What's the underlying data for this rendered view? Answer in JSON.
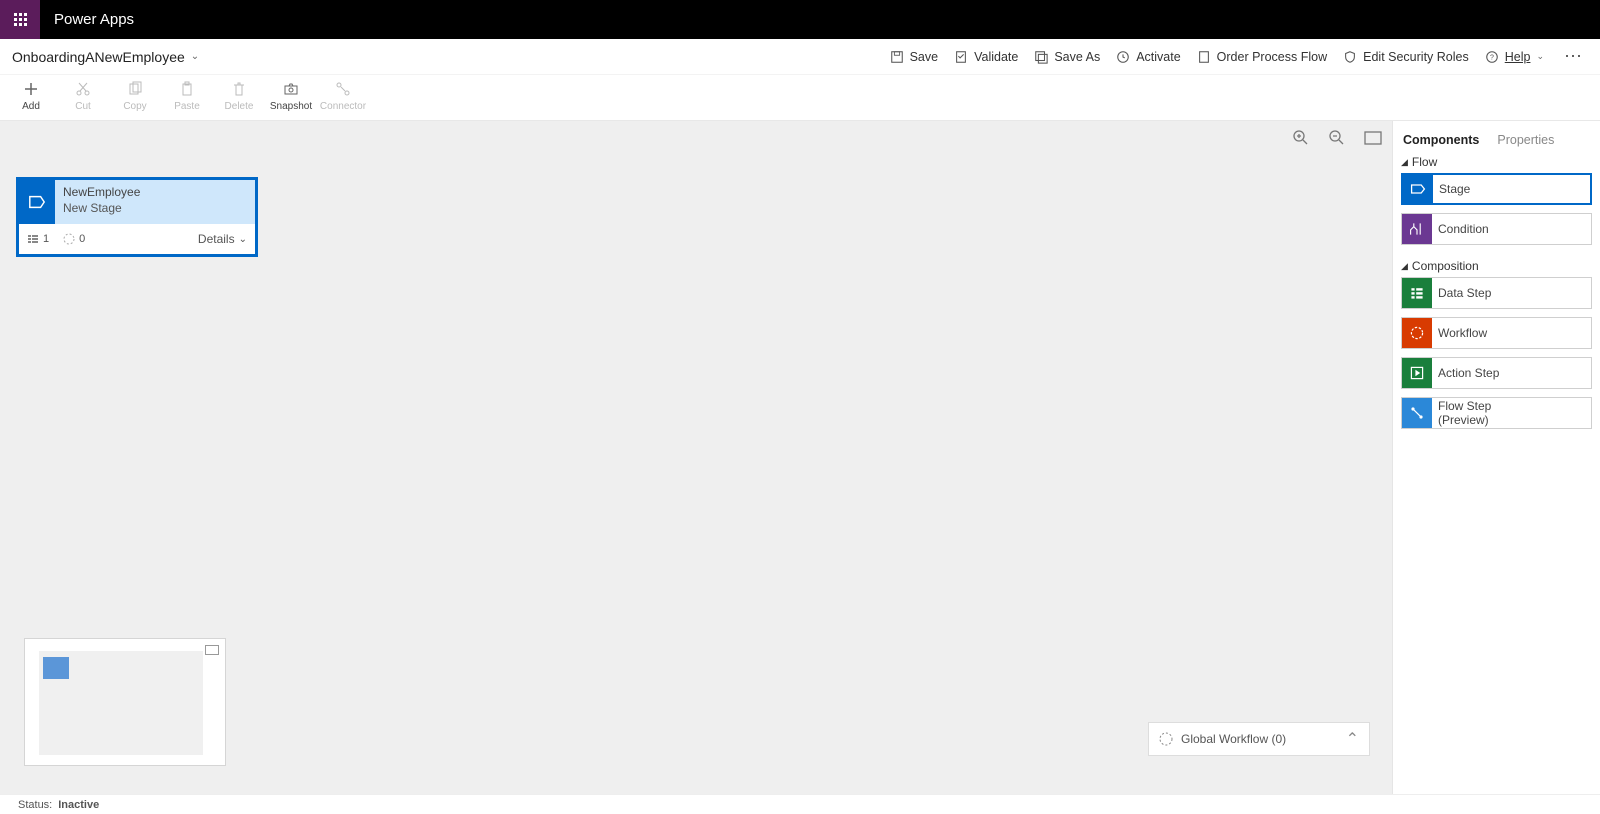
{
  "app": {
    "name": "Power Apps"
  },
  "process": {
    "name": "OnboardingANewEmployee"
  },
  "topActions": {
    "save": "Save",
    "validate": "Validate",
    "saveAs": "Save As",
    "activate": "Activate",
    "orderProcessFlow": "Order Process Flow",
    "editSecurityRoles": "Edit Security Roles",
    "help": "Help"
  },
  "toolbar": {
    "add": "Add",
    "cut": "Cut",
    "copy": "Copy",
    "paste": "Paste",
    "delete": "Delete",
    "snapshot": "Snapshot",
    "connector": "Connector"
  },
  "stage": {
    "title1": "NewEmployee",
    "title2": "New Stage",
    "stepCount": "1",
    "workflowCount": "0",
    "details": "Details"
  },
  "globalWorkflow": {
    "label": "Global Workflow (0)"
  },
  "rightPanel": {
    "tabs": {
      "components": "Components",
      "properties": "Properties"
    },
    "sections": {
      "flow": "Flow",
      "composition": "Composition"
    },
    "flowItems": {
      "stage": "Stage",
      "condition": "Condition"
    },
    "compositionItems": {
      "dataStep": "Data Step",
      "workflow": "Workflow",
      "actionStep": "Action Step",
      "flowStep": "Flow Step\n(Preview)"
    }
  },
  "status": {
    "label": "Status:",
    "value": "Inactive"
  }
}
